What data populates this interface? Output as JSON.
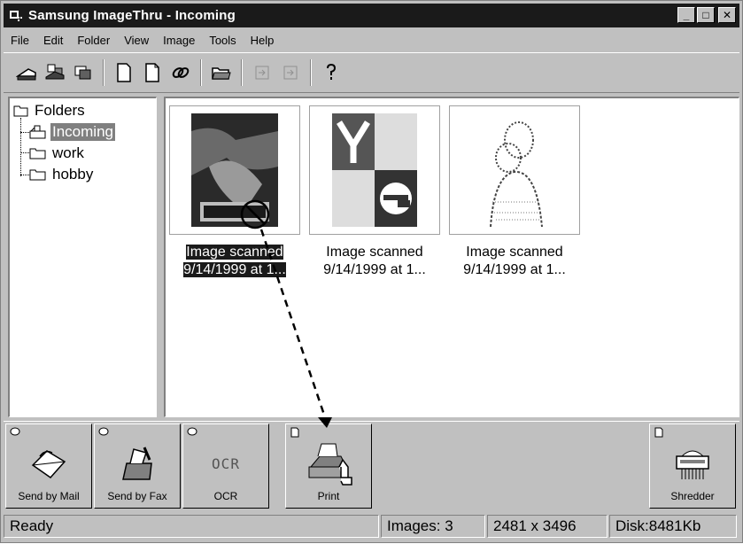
{
  "window": {
    "title": "Samsung ImageThru - Incoming",
    "controls": {
      "minimize": "_",
      "maximize": "□",
      "close": "✕"
    }
  },
  "menu": {
    "items": [
      {
        "label": "File"
      },
      {
        "label": "Edit"
      },
      {
        "label": "Folder"
      },
      {
        "label": "View"
      },
      {
        "label": "Image"
      },
      {
        "label": "Tools"
      },
      {
        "label": "Help"
      }
    ]
  },
  "toolbar": {
    "buttons": [
      {
        "icon": "scanner-icon"
      },
      {
        "icon": "scan-multi-icon"
      },
      {
        "icon": "acquire-icon"
      },
      {
        "icon": "new-document-icon"
      },
      {
        "icon": "copy-document-icon"
      },
      {
        "icon": "link-icon"
      },
      {
        "icon": "open-folder-icon"
      },
      {
        "icon": "import-icon",
        "disabled": true
      },
      {
        "icon": "export-icon",
        "disabled": true
      },
      {
        "icon": "help-icon"
      }
    ]
  },
  "folders": {
    "root": "Folders",
    "items": [
      {
        "label": "Incoming",
        "selected": true
      },
      {
        "label": "work",
        "selected": false
      },
      {
        "label": "hobby",
        "selected": false
      }
    ]
  },
  "images": [
    {
      "caption_line1": "Image scanned",
      "caption_line2": "9/14/1999 at 1...",
      "selected": true,
      "thumb": "xpress-figure-thumb"
    },
    {
      "caption_line1": "Image scanned",
      "caption_line2": "9/14/1999 at 1...",
      "selected": false,
      "thumb": "letters-ye-thumb"
    },
    {
      "caption_line1": "Image scanned",
      "caption_line2": "9/14/1999 at 1...",
      "selected": false,
      "thumb": "couple-portrait-thumb"
    }
  ],
  "actions": [
    {
      "label": "Send by Mail",
      "icon": "mail-icon"
    },
    {
      "label": "Send by Fax",
      "icon": "fax-icon"
    },
    {
      "label": "OCR",
      "icon": "ocr-icon",
      "icon_text": "OCR"
    },
    {
      "label": "Print",
      "icon": "printer-icon"
    },
    {
      "label": "Shredder",
      "icon": "shredder-icon"
    }
  ],
  "status": {
    "text": "Ready",
    "images": "Images: 3",
    "dimensions": "2481 x 3496",
    "disk": "Disk:8481Kb"
  },
  "colors": {
    "title_bar": "#1a1a1a",
    "face": "#c0c0c0",
    "selection": "#1a1a1a"
  }
}
